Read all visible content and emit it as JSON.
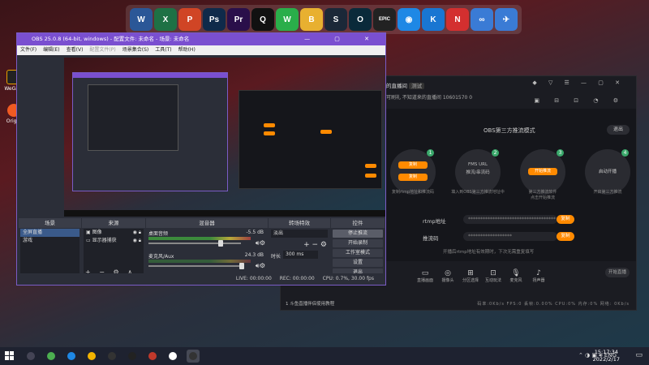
{
  "desktop": {
    "icons": [
      {
        "label": "WeGa..."
      },
      {
        "label": "Orig..."
      }
    ]
  },
  "dock": {
    "apps": [
      {
        "name": "word",
        "glyph": "W",
        "color": "#2b5797"
      },
      {
        "name": "excel",
        "glyph": "X",
        "color": "#1e7145"
      },
      {
        "name": "powerpoint",
        "glyph": "P",
        "color": "#d04525"
      },
      {
        "name": "photoshop",
        "glyph": "Ps",
        "color": "#0f2a4a"
      },
      {
        "name": "premiere",
        "glyph": "Pr",
        "color": "#2a0f4a"
      },
      {
        "name": "qq",
        "glyph": "Q",
        "color": "#111"
      },
      {
        "name": "wechat",
        "glyph": "W",
        "color": "#2aae4a"
      },
      {
        "name": "bear-app",
        "glyph": "B",
        "color": "#e8b030"
      },
      {
        "name": "steam",
        "glyph": "S",
        "color": "#1b2838"
      },
      {
        "name": "circle-app",
        "glyph": "O",
        "color": "#0a2a3a"
      },
      {
        "name": "epic-games",
        "glyph": "EPIC",
        "color": "#222"
      },
      {
        "name": "blue-app",
        "glyph": "◉",
        "color": "#1e88e5"
      },
      {
        "name": "k-app",
        "glyph": "K",
        "color": "#1976d2"
      },
      {
        "name": "netease-music",
        "glyph": "N",
        "color": "#d32f2f"
      },
      {
        "name": "baidu-netdisk",
        "glyph": "∞",
        "color": "#3a7bd5"
      },
      {
        "name": "feishu",
        "glyph": "✈",
        "color": "#3a7bd5"
      }
    ]
  },
  "stream_tool": {
    "title": "的直播间",
    "tag": "测试",
    "info": "可刷礼  不知道来的直播间  10601570  0",
    "heading": "OBS第三方推流模式",
    "exit_label": "退出",
    "steps": [
      {
        "num": "1",
        "pills": [
          "复制",
          "复制"
        ],
        "caption": "复制rtmp地址和推流码",
        "label": ""
      },
      {
        "num": "2",
        "pills": [],
        "caption": "填入到OBS第三方推流地址中",
        "label": "FMS URL\n推流/串流码"
      },
      {
        "num": "3",
        "pills": [
          "开始推流"
        ],
        "caption": "第三方推流软件\n点击开始推流",
        "label": ""
      },
      {
        "num": "4",
        "pills": [
          "启动开播"
        ],
        "caption": "开启第三方推流",
        "label": ""
      }
    ],
    "rtmp_label": "rtmp地址",
    "rtmp_value": "************************************",
    "key_label": "推流码",
    "key_value": "******************",
    "copy_label": "复制",
    "note": "开播后rtmp地址有效期时，下次无需重复填写",
    "tools": [
      "直播画面",
      "摄像头",
      "分区选择",
      "互动玩法",
      "麦克风",
      "扬声器"
    ],
    "golive_label": "开始直播",
    "status": "码率:0Kb/s  FPS:0  丢帧:0.00%  CPU:0%  内存:0%  网络:  0Kb/s",
    "bottom_left": "1 斗鱼直播伴侣使用教程"
  },
  "obs": {
    "title": "OBS 25.0.8 (64-bit, windows) - 配置文件: 未命名 - 场景: 未命名",
    "menu": [
      {
        "label": "文件(F)",
        "enabled": true
      },
      {
        "label": "编辑(E)",
        "enabled": true
      },
      {
        "label": "查看(V)",
        "enabled": true
      },
      {
        "label": "配置文件(P)",
        "enabled": false
      },
      {
        "label": "场景集合(S)",
        "enabled": true
      },
      {
        "label": "工具(T)",
        "enabled": true
      },
      {
        "label": "帮助(H)",
        "enabled": true
      }
    ],
    "scenes": {
      "header": "场景",
      "items": [
        "全屏直播",
        "游戏"
      ]
    },
    "sources": {
      "header": "来源",
      "items": [
        "图像",
        "显示器捕获"
      ]
    },
    "mixer": {
      "header": "混音器",
      "channels": [
        {
          "name": "桌面音频",
          "db": "-5.5 dB"
        },
        {
          "name": "麦克风/Aux",
          "db": "24.3 dB"
        }
      ]
    },
    "transition": {
      "header": "转场特效",
      "type": "淡出",
      "duration_label": "时长",
      "duration": "300 ms"
    },
    "controls": {
      "header": "控件",
      "buttons": [
        "停止推流",
        "开始录制",
        "工作室模式",
        "设置",
        "退出"
      ]
    },
    "status": {
      "live": "LIVE: 00:00:00",
      "rec": "REC: 00:00:00",
      "cpu": "CPU: 0.7%, 30.00 fps"
    }
  },
  "taskbar": {
    "apps": [
      {
        "name": "search",
        "color": "#445"
      },
      {
        "name": "chrome",
        "color": "#4caf50"
      },
      {
        "name": "edge",
        "color": "#1e88e5"
      },
      {
        "name": "file-explorer",
        "color": "#f4b400"
      },
      {
        "name": "app-4",
        "color": "#333"
      },
      {
        "name": "clock-app",
        "color": "#222"
      },
      {
        "name": "app-6",
        "color": "#c0392b"
      },
      {
        "name": "app-7",
        "color": "#fff"
      },
      {
        "name": "obs",
        "color": "#333"
      }
    ],
    "lang": "ENG",
    "time": "15:17:34",
    "date": "2022/2/17"
  }
}
